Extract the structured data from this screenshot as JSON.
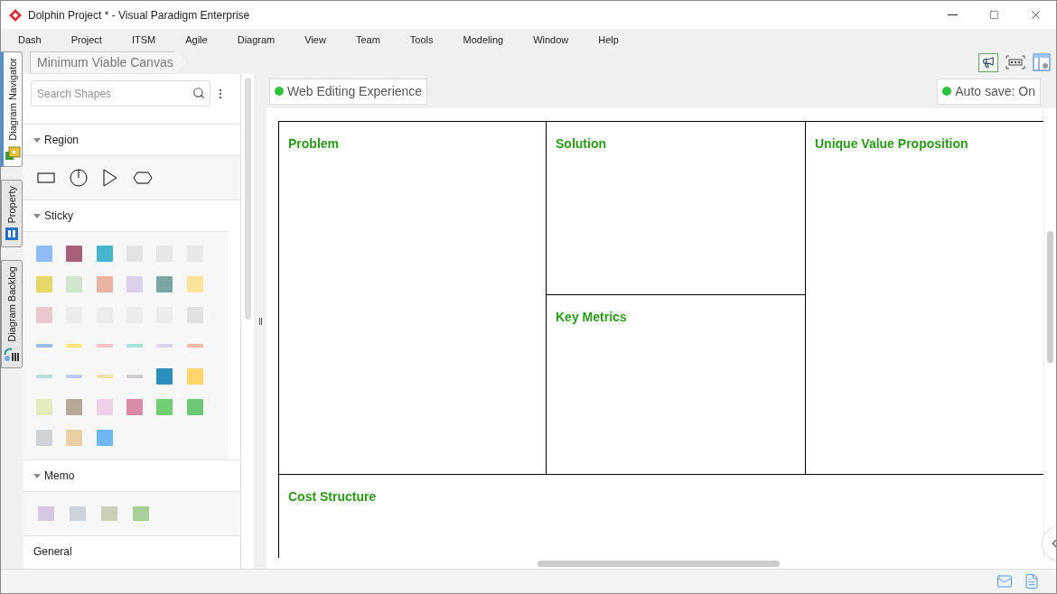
{
  "window": {
    "title": "Dolphin Project * - Visual Paradigm Enterprise"
  },
  "menu": [
    "Dash",
    "Project",
    "ITSM",
    "Agile",
    "Diagram",
    "View",
    "Team",
    "Tools",
    "Modeling",
    "Window",
    "Help"
  ],
  "side_tabs": [
    {
      "label": "Diagram Navigator",
      "selected": true,
      "kind": "navigator"
    },
    {
      "label": "Property",
      "selected": false,
      "kind": "property"
    },
    {
      "label": "Diagram Backlog",
      "selected": false,
      "kind": "backlog"
    }
  ],
  "breadcrumb": "Minimum Viable Canvas",
  "search": {
    "placeholder": "Search Shapes"
  },
  "palette": [
    {
      "name": "Region",
      "expanded": true,
      "kind": "region"
    },
    {
      "name": "Sticky",
      "expanded": true,
      "kind": "sticky"
    },
    {
      "name": "Memo",
      "expanded": true,
      "kind": "memo"
    },
    {
      "name": "General",
      "expanded": false
    }
  ],
  "toolbar": {
    "tag": {
      "label": "Web Editing Experience",
      "color": "#2dc23b"
    },
    "autosave": {
      "label": "Auto save: On",
      "color": "#2dc23b"
    }
  },
  "canvas": {
    "blocks": [
      {
        "title": "Problem"
      },
      {
        "title": "Solution"
      },
      {
        "title": "Unique Value Proposition"
      },
      {
        "title": "Key Metrics"
      },
      {
        "title": "Cost Structure"
      }
    ]
  }
}
